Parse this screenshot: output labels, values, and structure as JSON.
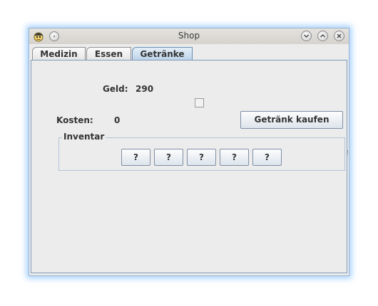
{
  "window": {
    "title": "Shop"
  },
  "tabs": [
    {
      "label": "Medizin",
      "selected": false
    },
    {
      "label": "Essen",
      "selected": false
    },
    {
      "label": "Getränke",
      "selected": true
    }
  ],
  "panel": {
    "money_label": "Geld:",
    "money_value": "290",
    "cost_label": "Kosten:",
    "cost_value": "0",
    "buy_button_label": "Getränk kaufen",
    "checkbox_checked": false,
    "inventory": {
      "legend": "Inventar",
      "slots": [
        "?",
        "?",
        "?",
        "?",
        "?"
      ]
    }
  },
  "colors": {
    "window_glow": "#5aaaff",
    "selected_tab": "#bcd3ea",
    "panel_background": "#ececec"
  },
  "icons": {
    "app": "app-face-icon",
    "pin": "pin-icon",
    "minimize": "chevron-down-icon",
    "maximize": "chevron-up-icon",
    "close": "close-icon"
  }
}
